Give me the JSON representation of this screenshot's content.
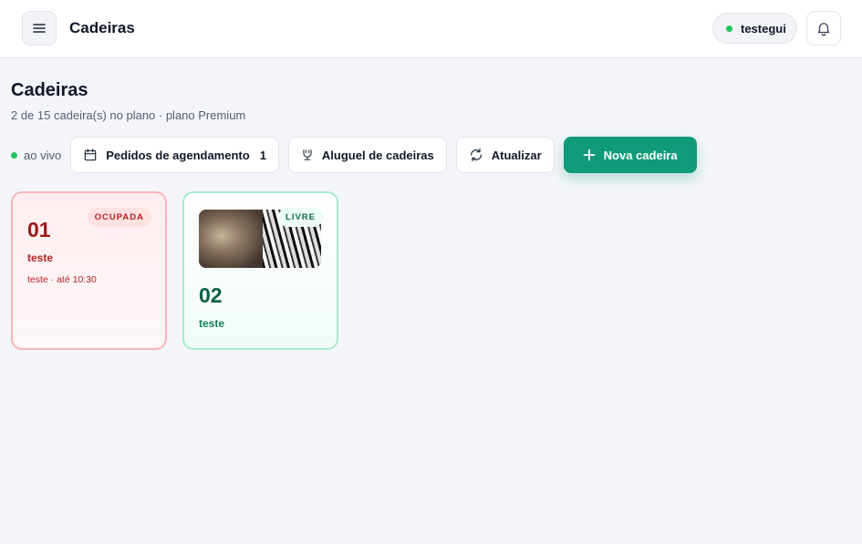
{
  "header": {
    "menu_icon": "hamburger-menu-icon",
    "title": "Cadeiras",
    "user": {
      "name": "testegui",
      "status_color": "#22c55e"
    },
    "bell_icon": "bell-icon"
  },
  "page": {
    "title": "Cadeiras",
    "subtitle": "2 de 15 cadeira(s) no plano · plano Premium"
  },
  "toolbar": {
    "live_label": "ao vivo",
    "live_color": "#22c55e",
    "buttons": [
      {
        "label": "Pedidos de agendamento",
        "icon": "calendar-icon",
        "count": "1"
      },
      {
        "label": "Aluguel de cadeiras",
        "icon": "chair-icon"
      },
      {
        "label": "Atualizar",
        "icon": "refresh-icon"
      },
      {
        "label": "Nova cadeira",
        "icon": "plus-icon",
        "accent": "#0f9b78"
      }
    ]
  },
  "chairs": [
    {
      "number": "01",
      "name": "teste",
      "status": "OCUPADA",
      "info": "teste · até 10:30",
      "status_color": "#b91c1c"
    },
    {
      "number": "02",
      "name": "teste",
      "status": "LIVRE",
      "has_photo": true,
      "status_color": "#0b6b52"
    }
  ]
}
